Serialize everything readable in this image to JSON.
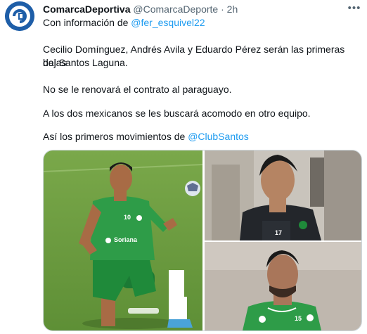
{
  "tweet": {
    "author_name": "ComarcaDeportiva",
    "author_handle": "@ComarcaDeporte",
    "separator": "·",
    "timestamp": "2h",
    "more_icon": "more-horizontal-icon",
    "info_prefix": "Con información de ",
    "info_mention": "@fer_esquivel22",
    "paragraph_1_line_1": "Cecilio Domínguez, Andrés Avila y Eduardo Pérez serán las primeras bajas",
    "paragraph_1_line_2": "del Santos Laguna.",
    "paragraph_2": "No se le renovará el contrato al paraguayo.",
    "paragraph_3": "A los dos mexicanos se les buscará acomodo en otro equipo.",
    "paragraph_4_prefix": "Así los primeros movimientos de ",
    "paragraph_4_mention": "@ClubSantos"
  },
  "media": {
    "photo_1": {
      "jersey_number": "10",
      "sponsor": "Soriana"
    },
    "photo_2": {
      "jersey_number": "17"
    },
    "photo_3": {
      "jersey_number": "15"
    }
  },
  "colors": {
    "link": "#1d9bf0",
    "secondary_text": "#536471",
    "santos_green": "#1f8a3a",
    "avatar_blue": "#1e5ea8"
  }
}
